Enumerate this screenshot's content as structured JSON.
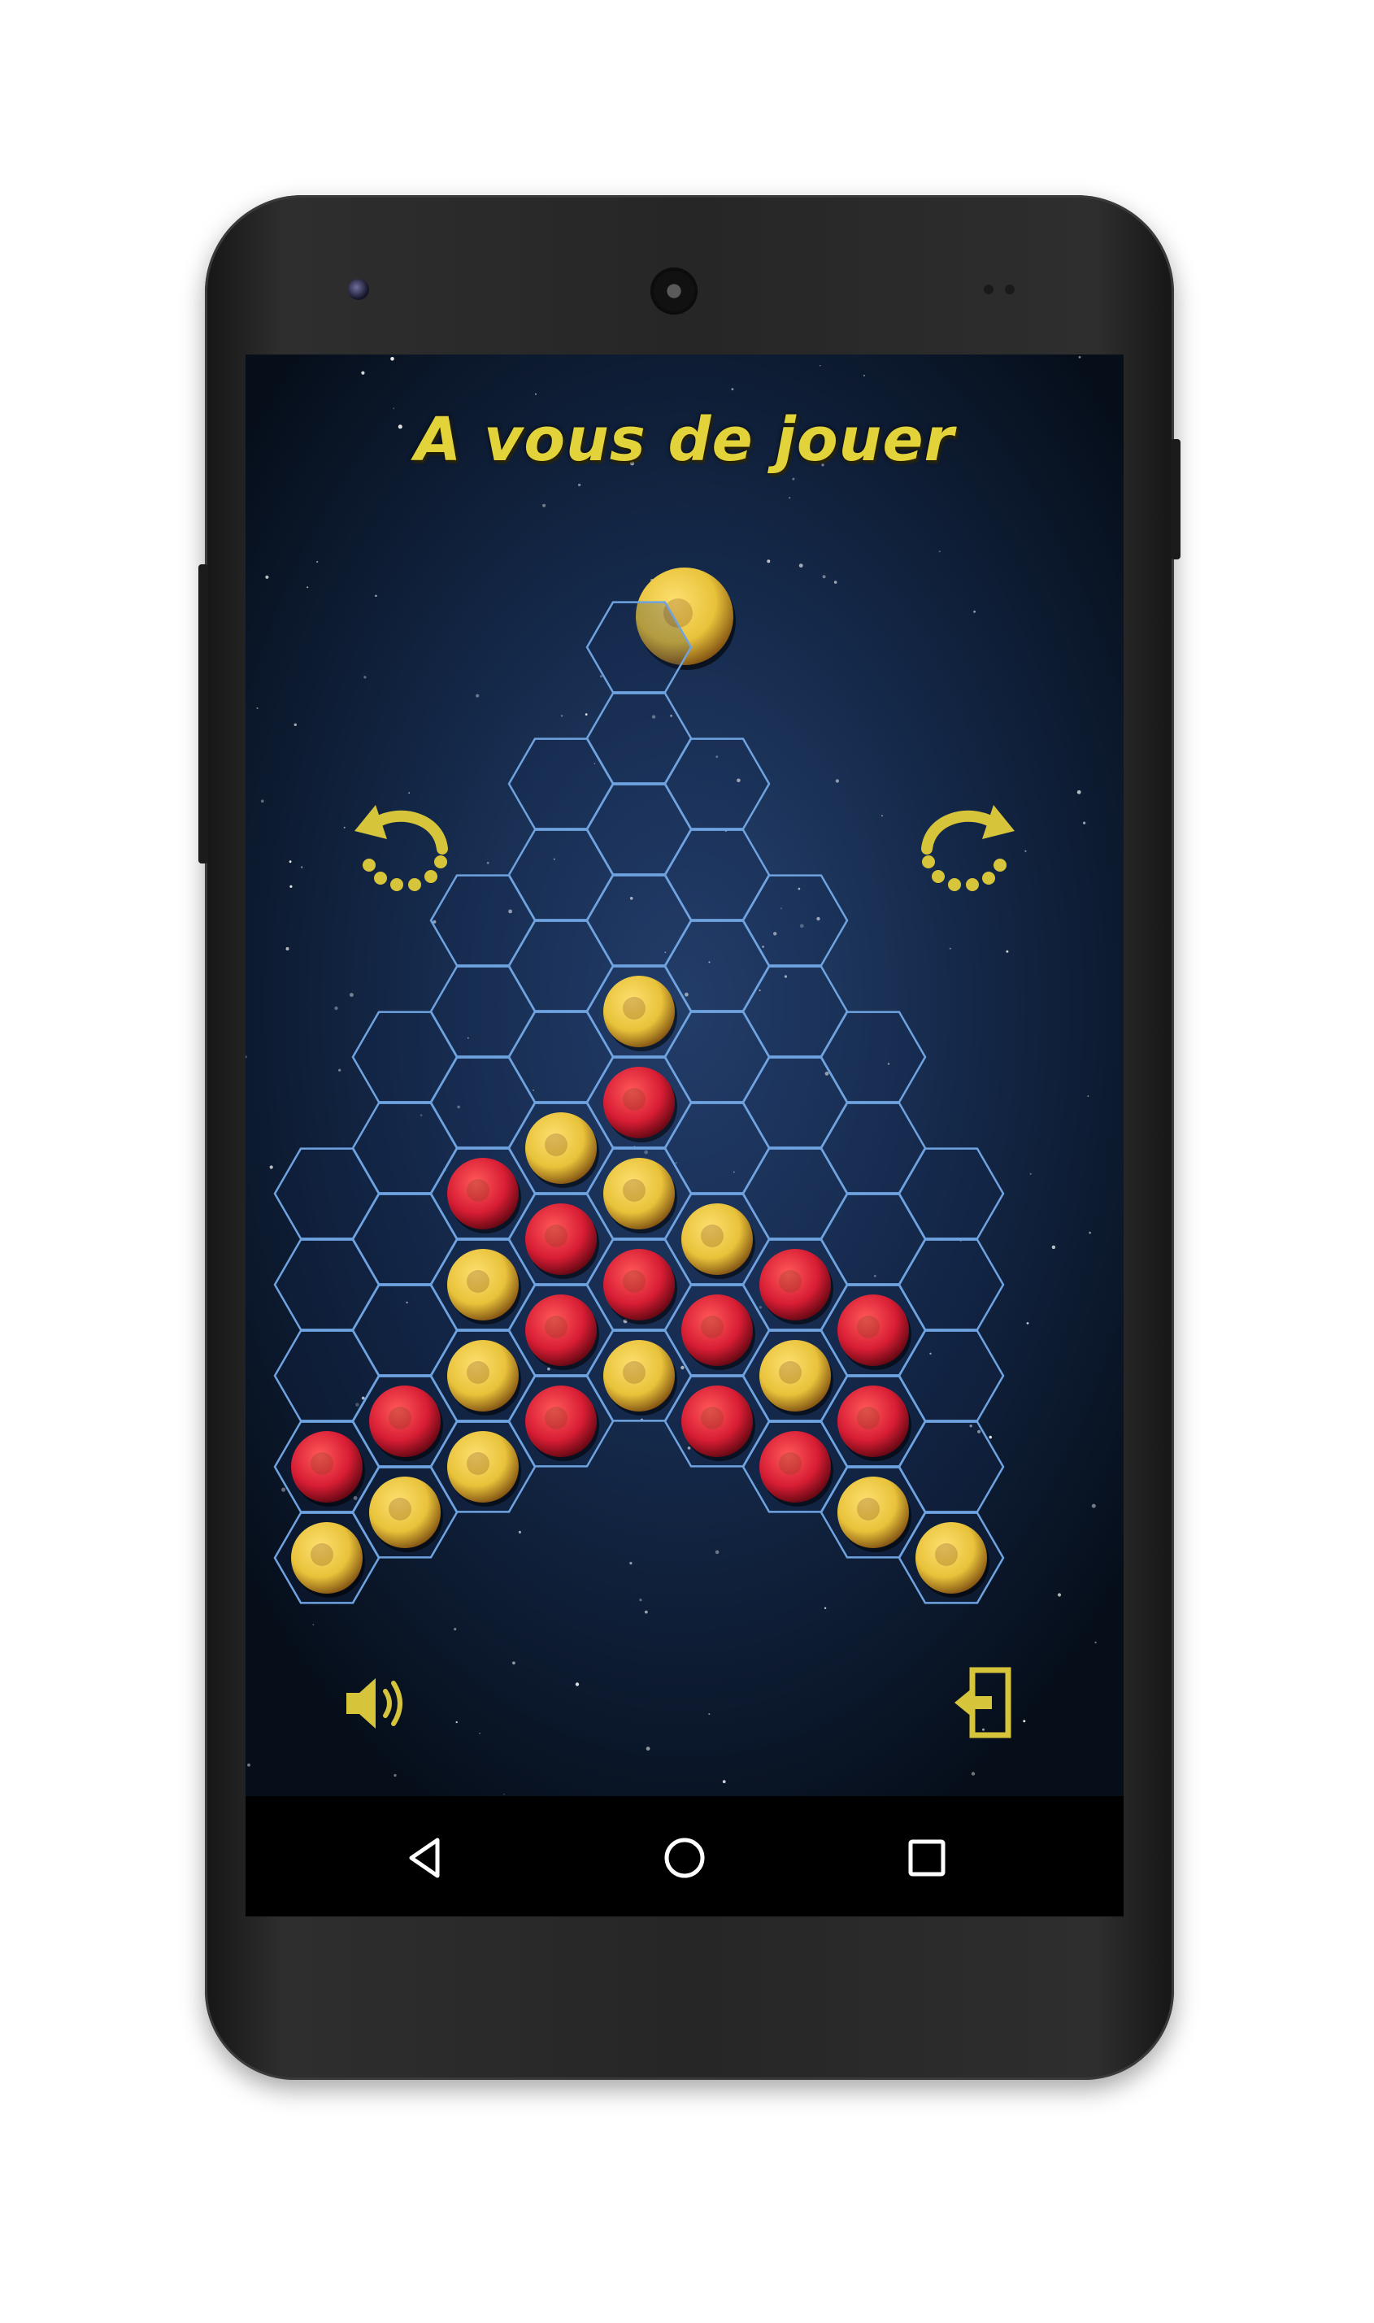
{
  "status": {
    "title": "A vous de jouer",
    "current_player": "yellow"
  },
  "colors": {
    "yellow": "#e8c23a",
    "red": "#d81d34",
    "title": "#e2d33a",
    "grid": "#6fa3e0",
    "icon": "#d6c43a"
  },
  "controls": {
    "undo_icon": "undo-arrow-icon",
    "redo_icon": "redo-arrow-icon",
    "sound_icon": "speaker-volume-icon",
    "exit_icon": "exit-door-icon"
  },
  "board": {
    "columns": 9,
    "column_heights": [
      5,
      6,
      7,
      8,
      9,
      8,
      7,
      6,
      5
    ],
    "pieces": [
      {
        "col": 0,
        "row": 0,
        "color": "yellow"
      },
      {
        "col": 0,
        "row": 1,
        "color": "red"
      },
      {
        "col": 1,
        "row": 0,
        "color": "yellow"
      },
      {
        "col": 1,
        "row": 1,
        "color": "red"
      },
      {
        "col": 2,
        "row": 0,
        "color": "yellow"
      },
      {
        "col": 2,
        "row": 1,
        "color": "yellow"
      },
      {
        "col": 2,
        "row": 2,
        "color": "yellow"
      },
      {
        "col": 2,
        "row": 3,
        "color": "red"
      },
      {
        "col": 3,
        "row": 0,
        "color": "red"
      },
      {
        "col": 3,
        "row": 1,
        "color": "red"
      },
      {
        "col": 3,
        "row": 2,
        "color": "red"
      },
      {
        "col": 3,
        "row": 3,
        "color": "yellow"
      },
      {
        "col": 4,
        "row": 0,
        "color": "yellow"
      },
      {
        "col": 4,
        "row": 1,
        "color": "red"
      },
      {
        "col": 4,
        "row": 2,
        "color": "yellow"
      },
      {
        "col": 4,
        "row": 3,
        "color": "red"
      },
      {
        "col": 4,
        "row": 4,
        "color": "yellow"
      },
      {
        "col": 5,
        "row": 0,
        "color": "red"
      },
      {
        "col": 5,
        "row": 1,
        "color": "red"
      },
      {
        "col": 5,
        "row": 2,
        "color": "yellow"
      },
      {
        "col": 6,
        "row": 0,
        "color": "red"
      },
      {
        "col": 6,
        "row": 1,
        "color": "yellow"
      },
      {
        "col": 6,
        "row": 2,
        "color": "red"
      },
      {
        "col": 7,
        "row": 0,
        "color": "yellow"
      },
      {
        "col": 7,
        "row": 1,
        "color": "red"
      },
      {
        "col": 7,
        "row": 2,
        "color": "red"
      },
      {
        "col": 8,
        "row": 0,
        "color": "yellow"
      }
    ]
  },
  "navbar": {
    "back_icon": "back-triangle-icon",
    "home_icon": "home-circle-icon",
    "recents_icon": "recents-square-icon"
  }
}
